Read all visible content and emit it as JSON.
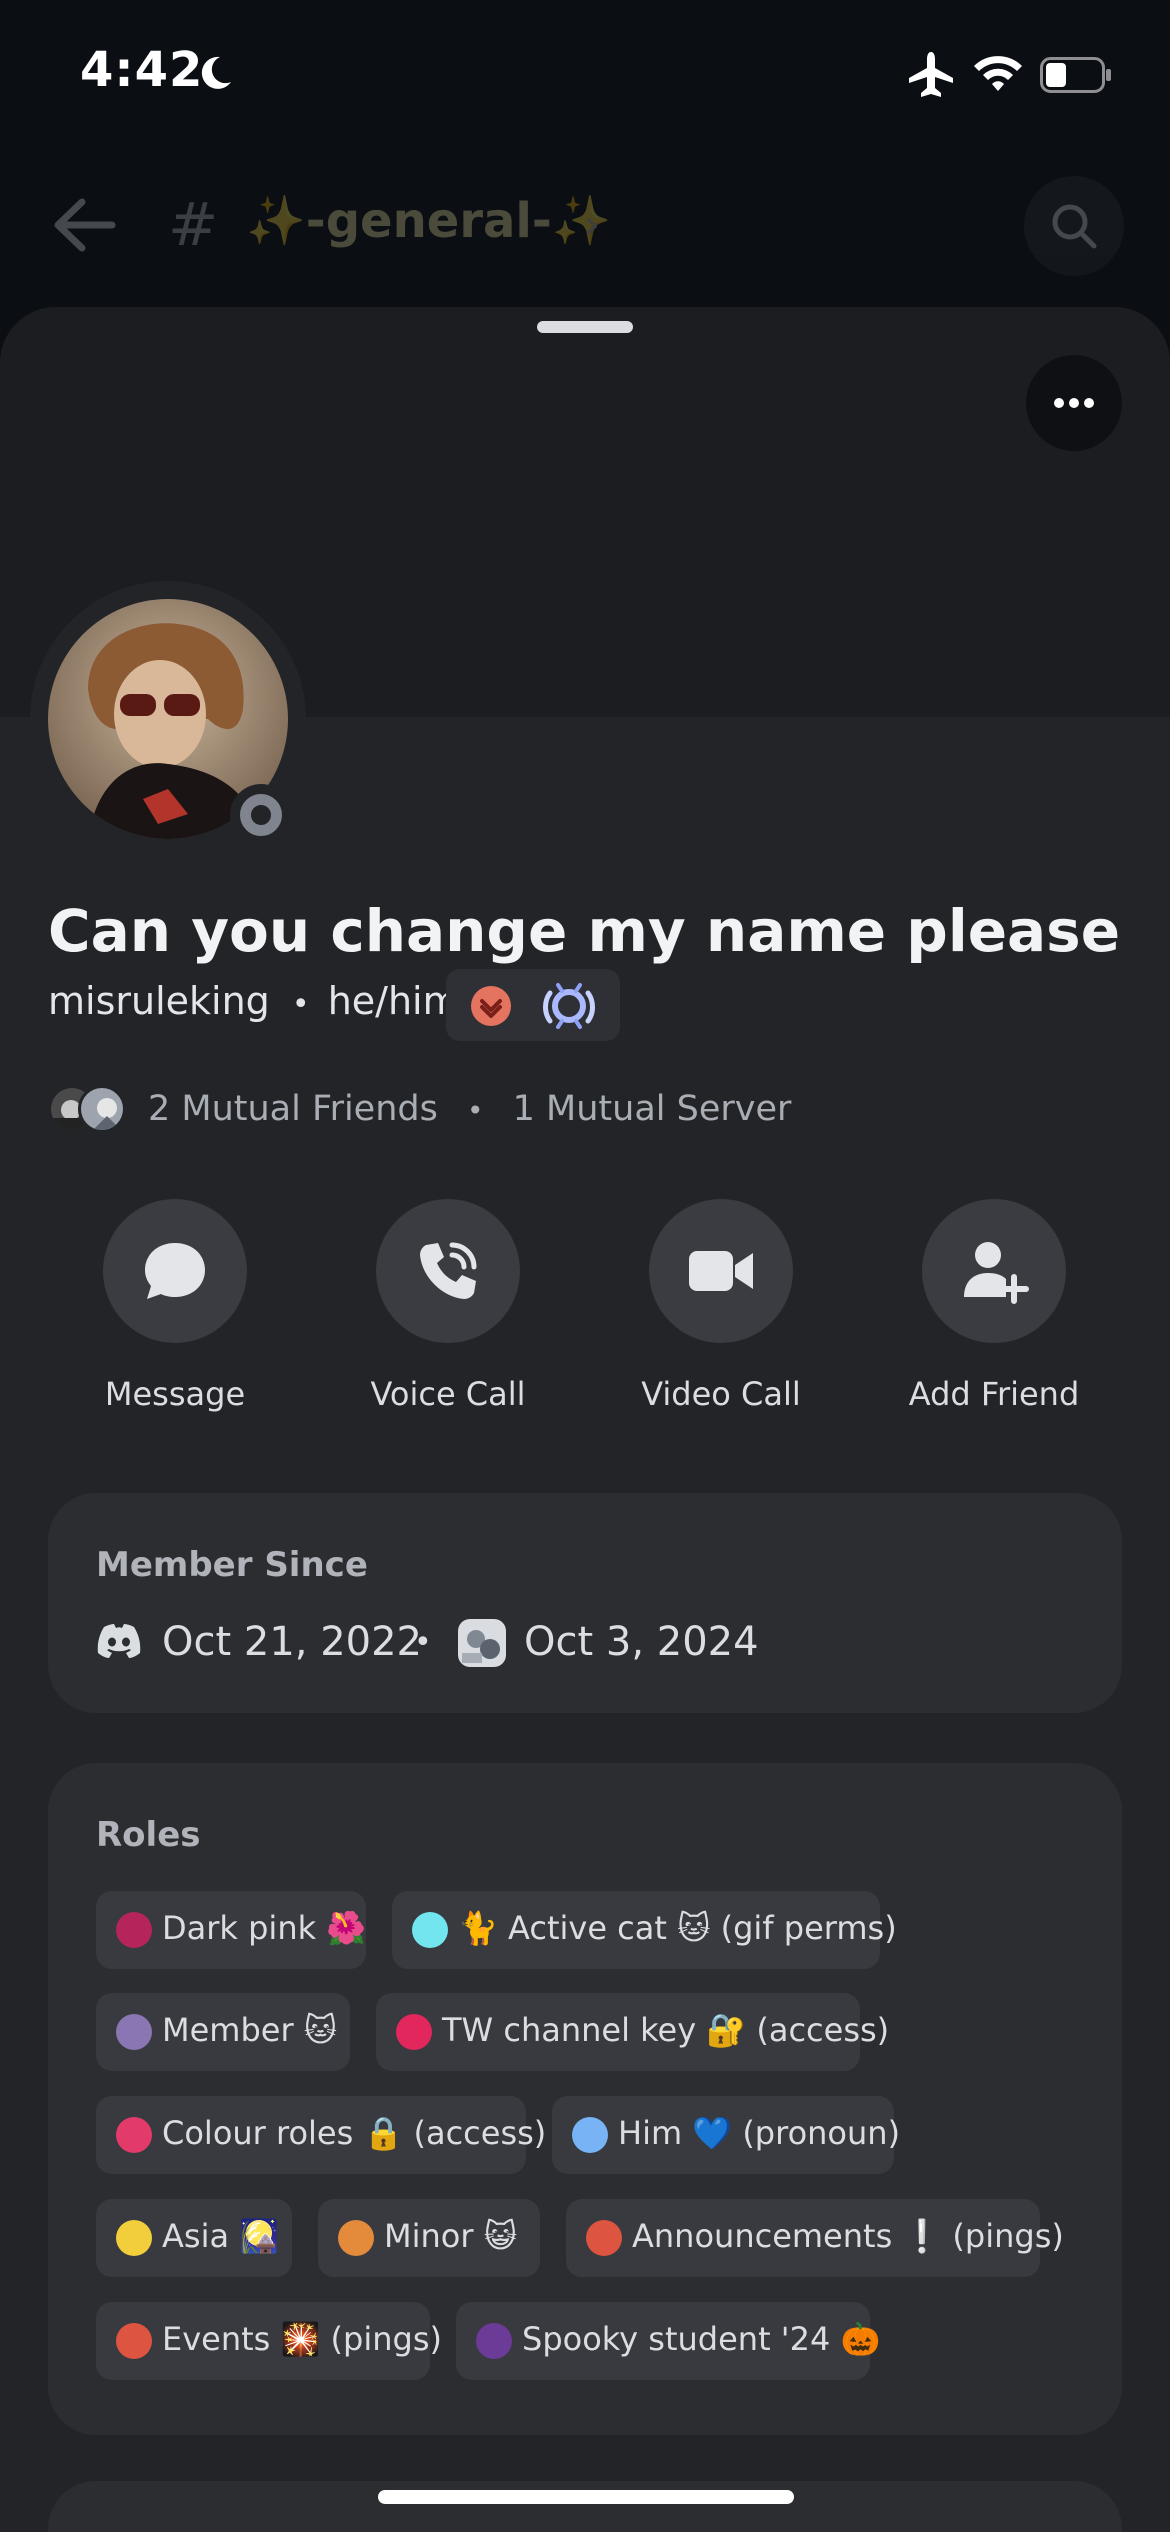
{
  "status_bar": {
    "time": "4:42",
    "icons": [
      "moon-icon",
      "airplane-icon",
      "wifi-icon",
      "battery-icon"
    ]
  },
  "channel_header": {
    "hash": "#",
    "channel_name": "✨-general-✨",
    "chevron": "›"
  },
  "profile": {
    "display_name": "Can you change my name please",
    "username": "misruleking",
    "separator": "•",
    "pronouns": "he/him",
    "badges": [
      "guild-tag-badge",
      "quest-badge"
    ],
    "status": "offline",
    "mutual_friends": "2 Mutual Friends",
    "mutual_dot": "•",
    "mutual_servers": "1 Mutual Server"
  },
  "actions": [
    {
      "label": "Message",
      "icon": "chat-bubble-icon"
    },
    {
      "label": "Voice Call",
      "icon": "phone-icon"
    },
    {
      "label": "Video Call",
      "icon": "video-camera-icon"
    },
    {
      "label": "Add Friend",
      "icon": "add-friend-icon"
    }
  ],
  "member_since": {
    "title": "Member Since",
    "discord_date": "Oct 21, 2022",
    "dot": "•",
    "server_date": "Oct 3, 2024"
  },
  "roles": {
    "title": "Roles",
    "items": [
      {
        "label": "Dark pink 🌺",
        "color": "#b5245a"
      },
      {
        "label": "🐈 Active cat 🐱 (gif perms)",
        "color": "#73e5ee"
      },
      {
        "label": "Member 🐱",
        "color": "#8a76b3"
      },
      {
        "label": "TW channel key 🔐 (access)",
        "color": "#e2275d"
      },
      {
        "label": "Colour roles 🔒 (access)",
        "color": "#e23b6a"
      },
      {
        "label": "Him 💙 (pronoun)",
        "color": "#78b4f5"
      },
      {
        "label": "Asia 🎑",
        "color": "#f2cd3c"
      },
      {
        "label": "Minor 😺",
        "color": "#e38a3b"
      },
      {
        "label": "Announcements ❕ (pings)",
        "color": "#dd5441"
      },
      {
        "label": "Events 🎇 (pings)",
        "color": "#dd5441"
      },
      {
        "label": "Spooky student '24 🎃",
        "color": "#6c3a97"
      }
    ]
  },
  "colors": {
    "sheet_bg": "#232428",
    "card_bg": "#2b2d31",
    "chip_bg": "#383a40",
    "status_offline": "#80848e"
  }
}
